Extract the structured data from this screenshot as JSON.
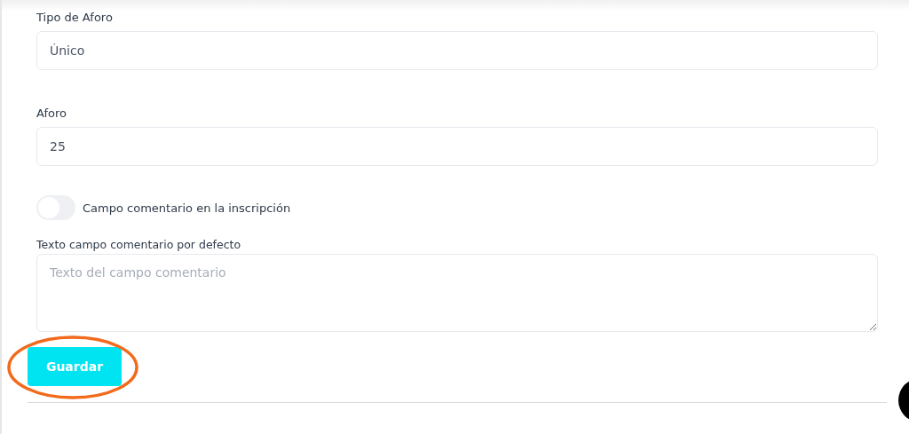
{
  "fields": [
    {
      "kind": "input",
      "label": "Tipo de Aforo",
      "value": "Único"
    },
    {
      "kind": "input",
      "label": "Aforo",
      "value": "25"
    },
    {
      "kind": "toggle",
      "label": "Campo comentario en la inscripción",
      "on": false
    },
    {
      "kind": "textarea",
      "label": "Texto campo comentario por defecto",
      "placeholder": "Texto del campo comentario"
    }
  ],
  "save_button": {
    "label": "Guardar",
    "circled": true
  }
}
